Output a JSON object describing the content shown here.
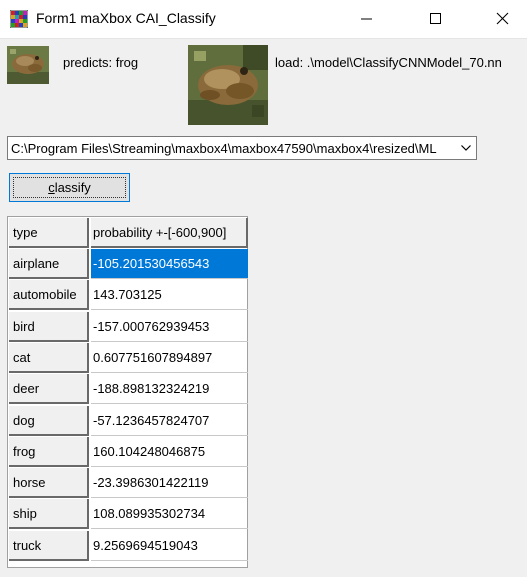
{
  "window": {
    "title": "Form1 maXbox CAI_Classify"
  },
  "prediction": {
    "label": "predicts: frog"
  },
  "model": {
    "label": "load: .\\model\\ClassifyCNNModel_70.nn"
  },
  "path_combo": {
    "value": "C:\\Program Files\\Streaming\\maxbox4\\maxbox47590\\maxbox4\\resized\\ML"
  },
  "classify_button": {
    "label_prefix": "",
    "label_hotkey": "c",
    "label_rest": "lassify"
  },
  "grid": {
    "headers": [
      "type",
      "probability +-[-600,900]"
    ],
    "rows": [
      {
        "type": "airplane",
        "value": "-105.201530456543",
        "selected": true
      },
      {
        "type": "automobile",
        "value": "143.703125"
      },
      {
        "type": "bird",
        "value": "-157.000762939453"
      },
      {
        "type": "cat",
        "value": "0.607751607894897"
      },
      {
        "type": "deer",
        "value": "-188.898132324219"
      },
      {
        "type": "dog",
        "value": "-57.1236457824707"
      },
      {
        "type": "frog",
        "value": "160.104248046875"
      },
      {
        "type": "horse",
        "value": "-23.3986301422119"
      },
      {
        "type": "ship",
        "value": "108.089935302734"
      },
      {
        "type": "truck",
        "value": "9.2569694519043"
      }
    ]
  },
  "colors": {
    "selection": "#0078d7",
    "accent_border": "#0078d7"
  },
  "icons": {
    "app": "maxbox-grid-icon",
    "minimize": "minimize-icon",
    "maximize": "maximize-icon",
    "close": "close-icon",
    "dropdown": "chevron-down-icon"
  }
}
